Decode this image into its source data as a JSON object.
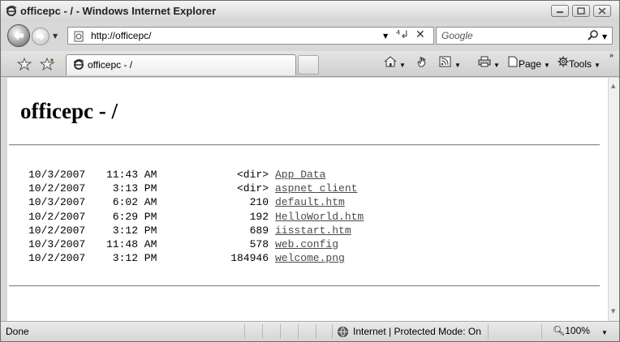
{
  "window": {
    "title": "officepc - / - Windows Internet Explorer"
  },
  "address_bar": {
    "url": "http://officepc/"
  },
  "search": {
    "placeholder": "Google"
  },
  "tab": {
    "label": "officepc - /"
  },
  "command_bar": {
    "page_label": "Page",
    "tools_label": "Tools"
  },
  "content": {
    "heading": "officepc - /",
    "listing": [
      {
        "date": "10/3/2007",
        "time": "11:43 AM",
        "size": "<dir>",
        "name": "App_Data"
      },
      {
        "date": "10/2/2007",
        "time": " 3:13 PM",
        "size": "<dir>",
        "name": "aspnet_client"
      },
      {
        "date": "10/3/2007",
        "time": " 6:02 AM",
        "size": "210",
        "name": "default.htm"
      },
      {
        "date": "10/2/2007",
        "time": " 6:29 PM",
        "size": "192",
        "name": "HelloWorld.htm"
      },
      {
        "date": "10/2/2007",
        "time": " 3:12 PM",
        "size": "689",
        "name": "iisstart.htm"
      },
      {
        "date": "10/3/2007",
        "time": "11:48 AM",
        "size": "578",
        "name": "web.config"
      },
      {
        "date": "10/2/2007",
        "time": " 3:12 PM",
        "size": "184946",
        "name": "welcome.png"
      }
    ]
  },
  "status_bar": {
    "status": "Done",
    "zone": "Internet | Protected Mode: On",
    "zoom": "100%"
  },
  "colors": {
    "link": "#4a4a4a",
    "chrome": "#d8d8d8"
  }
}
